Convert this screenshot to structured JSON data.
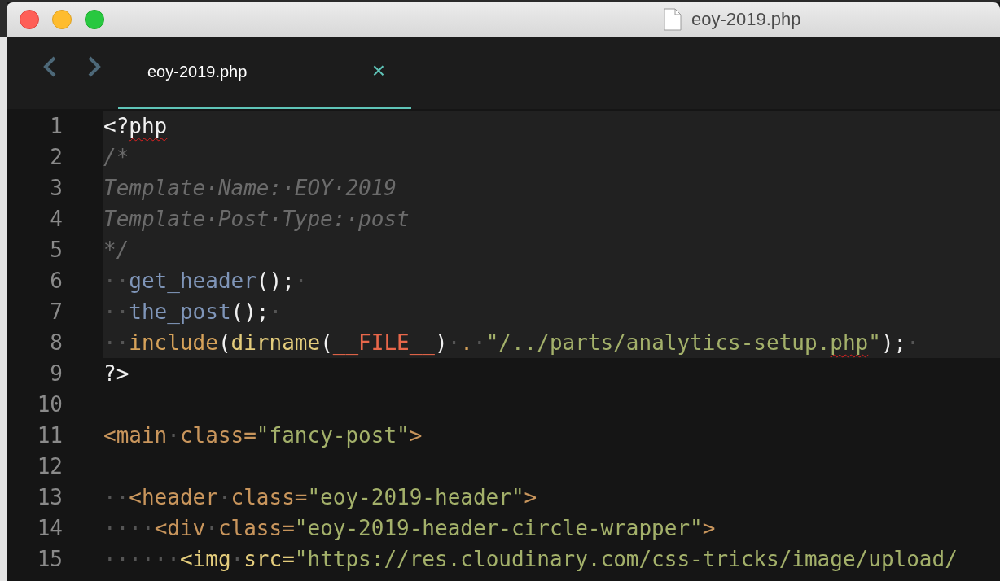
{
  "window": {
    "title": "eoy-2019.php"
  },
  "tabs": [
    {
      "label": "eoy-2019.php",
      "selected": true,
      "close": "×"
    }
  ],
  "lines": [
    {
      "number": "1",
      "highlighted": true,
      "tokens": [
        {
          "kind": "plain",
          "text": "<?"
        },
        {
          "kind": "plain",
          "text": "php",
          "misspelled": true
        }
      ]
    },
    {
      "number": "2",
      "highlighted": true,
      "tokens": [
        {
          "kind": "comment",
          "text": "/*"
        }
      ]
    },
    {
      "number": "3",
      "highlighted": true,
      "tokens": [
        {
          "kind": "comment",
          "text": "Template·Name:·EOY·2019"
        }
      ]
    },
    {
      "number": "4",
      "highlighted": true,
      "tokens": [
        {
          "kind": "comment",
          "text": "Template·Post·Type:·post"
        }
      ]
    },
    {
      "number": "5",
      "highlighted": true,
      "tokens": [
        {
          "kind": "comment",
          "text": "*/"
        }
      ]
    },
    {
      "number": "6",
      "highlighted": true,
      "tokens": [
        {
          "kind": "ws",
          "text": "··"
        },
        {
          "kind": "func",
          "text": "get_header"
        },
        {
          "kind": "plain",
          "text": "();"
        },
        {
          "kind": "ws",
          "text": "·"
        }
      ]
    },
    {
      "number": "7",
      "highlighted": true,
      "tokens": [
        {
          "kind": "ws",
          "text": "··"
        },
        {
          "kind": "func",
          "text": "the_post"
        },
        {
          "kind": "plain",
          "text": "();"
        },
        {
          "kind": "ws",
          "text": "·"
        }
      ]
    },
    {
      "number": "8",
      "highlighted": true,
      "tokens": [
        {
          "kind": "ws",
          "text": "··"
        },
        {
          "kind": "keyword",
          "text": "include"
        },
        {
          "kind": "plain",
          "text": "("
        },
        {
          "kind": "builtin",
          "text": "dirname"
        },
        {
          "kind": "plain",
          "text": "("
        },
        {
          "kind": "const",
          "text": "__FILE__"
        },
        {
          "kind": "plain",
          "text": ")"
        },
        {
          "kind": "ws",
          "text": "·"
        },
        {
          "kind": "keyword",
          "text": "."
        },
        {
          "kind": "ws",
          "text": "·"
        },
        {
          "kind": "string",
          "text": "\"/../parts/analytics-setup."
        },
        {
          "kind": "string",
          "text": "php",
          "misspelled": true
        },
        {
          "kind": "string",
          "text": "\""
        },
        {
          "kind": "plain",
          "text": ");"
        },
        {
          "kind": "ws",
          "text": "·"
        }
      ]
    },
    {
      "number": "9",
      "highlighted": false,
      "tokens": [
        {
          "kind": "plain",
          "text": "?>"
        }
      ]
    },
    {
      "number": "10",
      "highlighted": false
    },
    {
      "number": "11",
      "highlighted": false,
      "tokens": [
        {
          "kind": "tag",
          "text": "<main"
        },
        {
          "kind": "ws",
          "text": "·"
        },
        {
          "kind": "tag",
          "text": "class="
        },
        {
          "kind": "string",
          "text": "\"fancy-post\""
        },
        {
          "kind": "tag",
          "text": ">"
        }
      ]
    },
    {
      "number": "12",
      "highlighted": false
    },
    {
      "number": "13",
      "highlighted": false,
      "tokens": [
        {
          "kind": "ws",
          "text": "··"
        },
        {
          "kind": "tag",
          "text": "<header"
        },
        {
          "kind": "ws",
          "text": "·"
        },
        {
          "kind": "tag",
          "text": "class="
        },
        {
          "kind": "string",
          "text": "\"eoy-2019-header\""
        },
        {
          "kind": "tag",
          "text": ">"
        }
      ]
    },
    {
      "number": "14",
      "highlighted": false,
      "tokens": [
        {
          "kind": "ws",
          "text": "····"
        },
        {
          "kind": "tag",
          "text": "<div"
        },
        {
          "kind": "ws",
          "text": "·"
        },
        {
          "kind": "tag",
          "text": "class="
        },
        {
          "kind": "string",
          "text": "\"eoy-2019-header-circle-wrapper\""
        },
        {
          "kind": "tag",
          "text": ">"
        }
      ]
    },
    {
      "number": "15",
      "highlighted": false,
      "tokens": [
        {
          "kind": "ws",
          "text": "······"
        },
        {
          "kind": "builtin",
          "text": "<img"
        },
        {
          "kind": "ws",
          "text": "·"
        },
        {
          "kind": "builtin",
          "text": "src="
        },
        {
          "kind": "string",
          "text": "\"https://res.cloudinary.com/css-tricks/image/upload/"
        }
      ]
    }
  ]
}
